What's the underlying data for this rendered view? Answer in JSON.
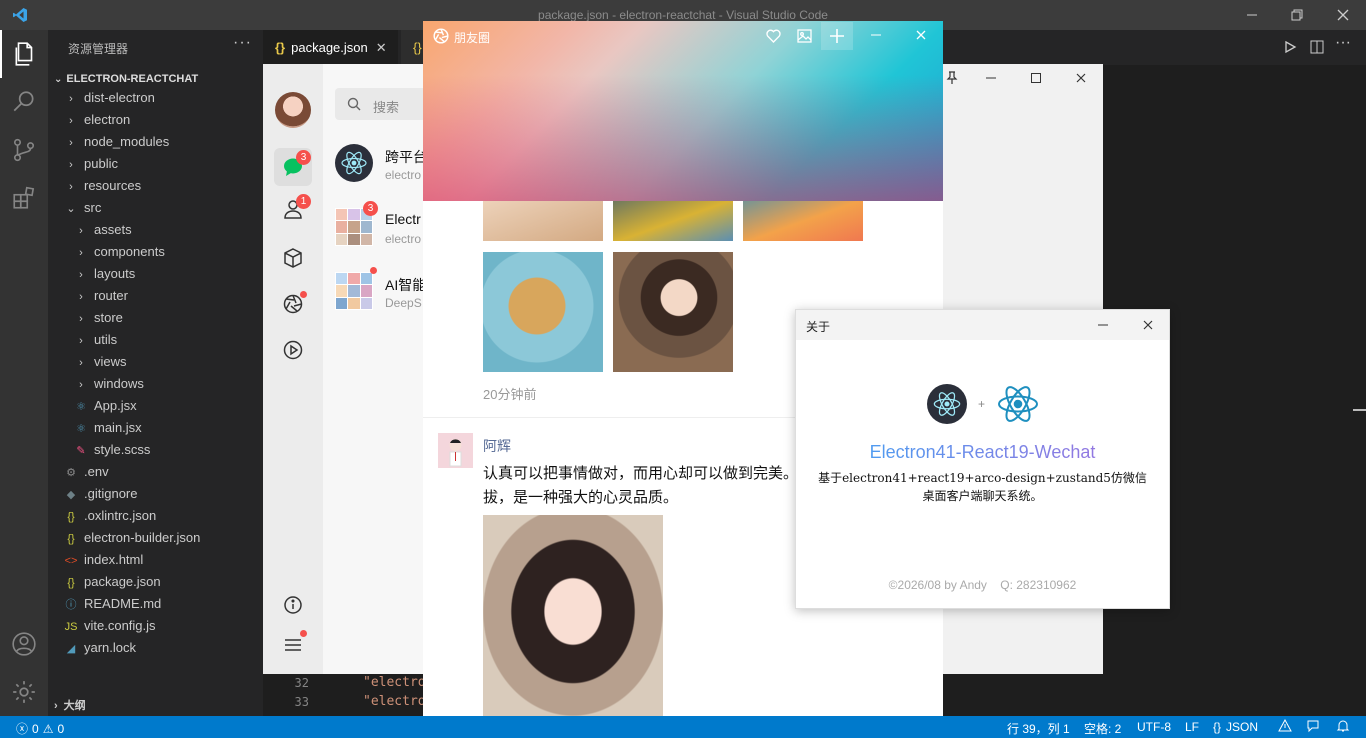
{
  "vscode": {
    "title": "package.json - electron-reactchat - Visual Studio Code",
    "explorer_title": "资源管理器",
    "root_folder": "ELECTRON-REACTCHAT",
    "tree": [
      {
        "label": "dist-electron",
        "kind": "folder"
      },
      {
        "label": "electron",
        "kind": "folder"
      },
      {
        "label": "node_modules",
        "kind": "folder"
      },
      {
        "label": "public",
        "kind": "folder"
      },
      {
        "label": "resources",
        "kind": "folder"
      },
      {
        "label": "src",
        "kind": "folder-open"
      },
      {
        "label": "assets",
        "kind": "folder"
      },
      {
        "label": "components",
        "kind": "folder"
      },
      {
        "label": "layouts",
        "kind": "folder"
      },
      {
        "label": "router",
        "kind": "folder"
      },
      {
        "label": "store",
        "kind": "folder"
      },
      {
        "label": "utils",
        "kind": "folder"
      },
      {
        "label": "views",
        "kind": "folder"
      },
      {
        "label": "windows",
        "kind": "folder"
      },
      {
        "label": "App.jsx",
        "kind": "react"
      },
      {
        "label": "main.jsx",
        "kind": "react"
      },
      {
        "label": "style.scss",
        "kind": "scss"
      },
      {
        "label": ".env",
        "kind": "gear"
      },
      {
        "label": ".gitignore",
        "kind": "git"
      },
      {
        "label": ".oxlintrc.json",
        "kind": "json"
      },
      {
        "label": "electron-builder.json",
        "kind": "json"
      },
      {
        "label": "index.html",
        "kind": "html"
      },
      {
        "label": "package.json",
        "kind": "json"
      },
      {
        "label": "README.md",
        "kind": "info"
      },
      {
        "label": "vite.config.js",
        "kind": "js"
      },
      {
        "label": "yarn.lock",
        "kind": "yarn"
      }
    ],
    "outline_label": "大纲",
    "tabs": [
      {
        "label": "package.json",
        "icon": "{}"
      },
      {
        "label": "{}"
      }
    ],
    "code_lines": [
      {
        "num": "32",
        "text": "\"electro"
      },
      {
        "num": "33",
        "text": "\"electro"
      }
    ],
    "status": {
      "errors": "0",
      "warnings": "0",
      "position": "行 39，列 1",
      "spaces": "空格: 2",
      "encoding": "UTF-8",
      "eol": "LF",
      "language": "JSON"
    }
  },
  "chat": {
    "search_placeholder": "搜索",
    "rail_badges": {
      "chat": "3",
      "contacts": "1"
    },
    "conversations": [
      {
        "name": "跨平台",
        "preview": "electro",
        "badge": ""
      },
      {
        "name": "Electr",
        "preview": "electro",
        "badge": "3"
      },
      {
        "name": "AI智能",
        "preview": "DeepS",
        "badge": ""
      }
    ]
  },
  "moments": {
    "title": "朋友圈",
    "time_ago": "20分钟前",
    "post": {
      "author": "阿辉",
      "text_line1": "认真可以把事情做对，而用心却可以做到完美。",
      "text_line2": "拔，是一种强大的心灵品质。"
    }
  },
  "about": {
    "title": "关于",
    "plus": "+",
    "app_name": "Electron41-React19-Wechat",
    "desc_line1": "基于electron41+react19+arco-design+zustand5仿微信",
    "desc_line2": "桌面客户端聊天系统。",
    "footer": "©2026/08 by Andy    Q: 282310962"
  },
  "colors": {
    "accent": "#007acc",
    "brand_green": "#07c160",
    "badge_red": "#f5504c",
    "about_gradient_start": "#3aa7f5",
    "about_gradient_end": "#a86cdc"
  }
}
